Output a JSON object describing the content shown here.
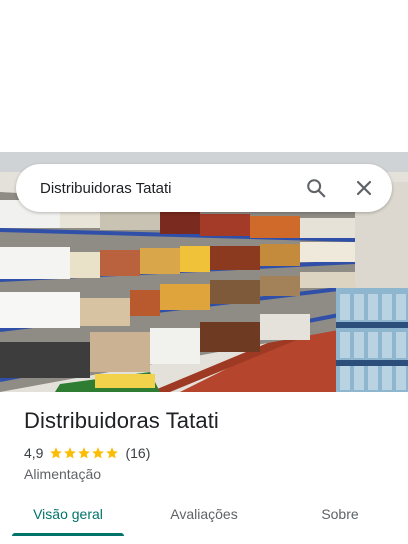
{
  "search": {
    "query": "Distribuidoras Tatati",
    "search_icon": "search-icon",
    "clear_icon": "close-icon"
  },
  "place": {
    "name": "Distribuidoras Tatati",
    "rating": "4,9",
    "rating_value": 4.9,
    "review_count": "(16)",
    "category": "Alimentação"
  },
  "tabs": [
    {
      "label": "Visão geral",
      "active": true
    },
    {
      "label": "Avaliações",
      "active": false
    },
    {
      "label": "Sobre",
      "active": false
    }
  ],
  "colors": {
    "accent": "#00736a",
    "star": "#fbbc04"
  }
}
